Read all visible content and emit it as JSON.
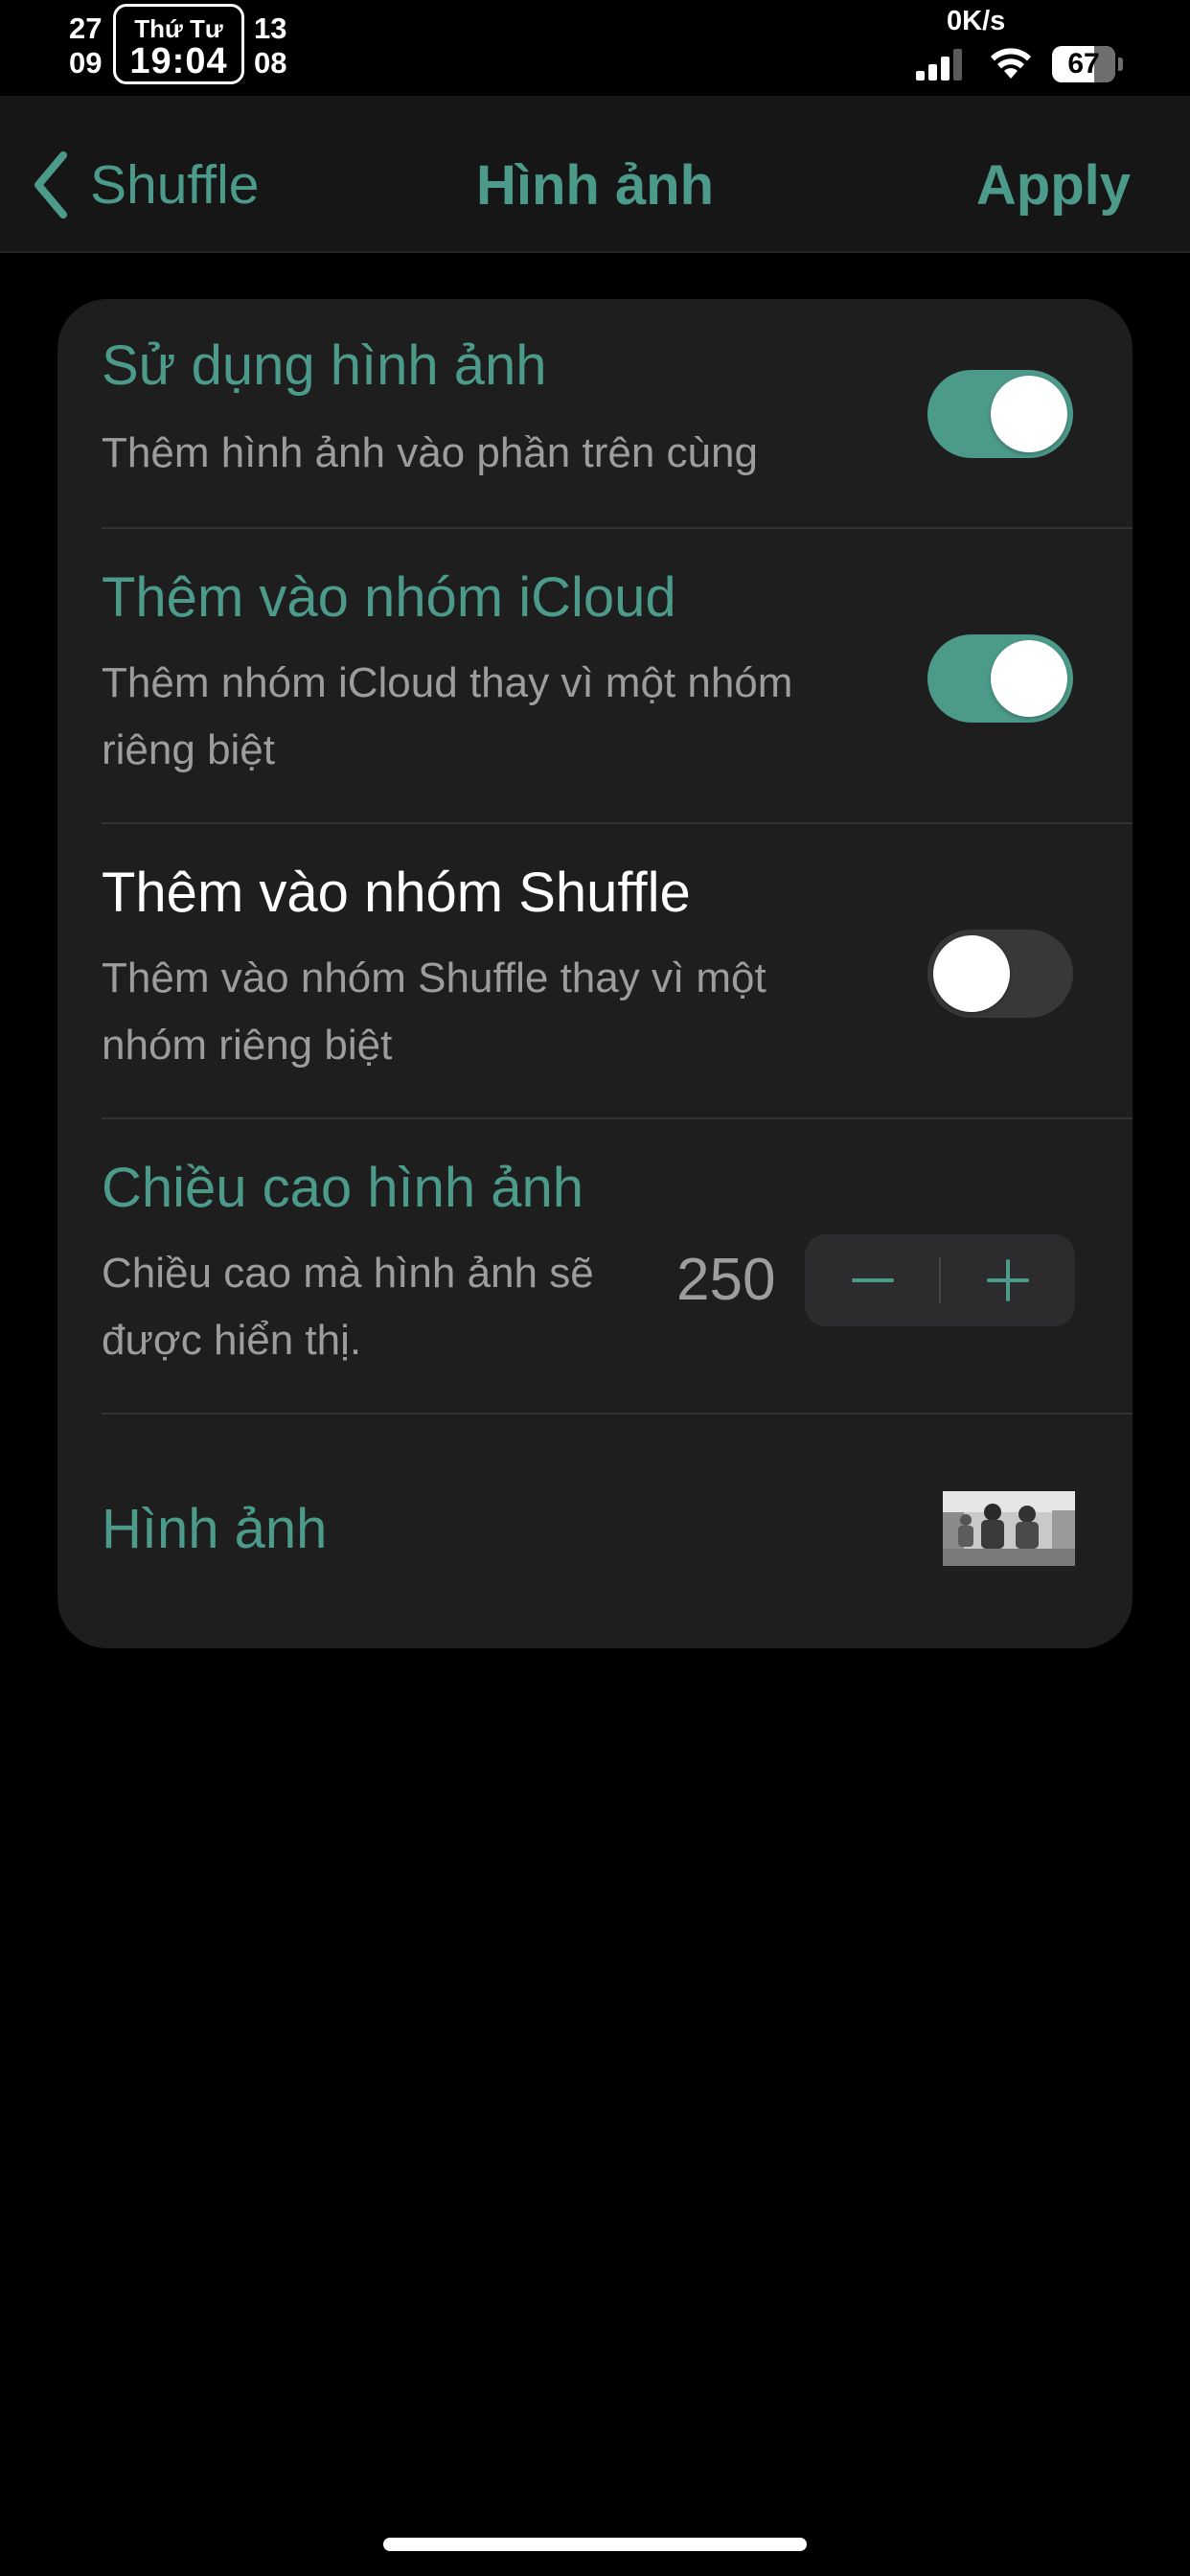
{
  "status_bar": {
    "date_left_top": "27",
    "date_left_bottom": "09",
    "weekday": "Thứ Tư",
    "time": "19:04",
    "date_right_top": "13",
    "date_right_bottom": "08",
    "network_speed": "0K/s",
    "battery_percent": "67",
    "icons": [
      "signal-icon",
      "wifi-icon",
      "battery-icon"
    ]
  },
  "nav": {
    "back_label": "Shuffle",
    "title": "Hình ảnh",
    "apply_label": "Apply"
  },
  "settings": {
    "use_image": {
      "title": "Sử dụng hình ảnh",
      "description": "Thêm hình ảnh vào phần trên cùng",
      "enabled": true
    },
    "icloud_group": {
      "title": "Thêm vào nhóm iCloud",
      "description_line1": "Thêm nhóm iCloud thay vì một nhóm",
      "description_line2": "riêng biệt",
      "enabled": true
    },
    "shuffle_group": {
      "title": "Thêm vào nhóm Shuffle",
      "description_line1": "Thêm vào nhóm Shuffle thay vì một",
      "description_line2": "nhóm riêng biệt",
      "enabled": false
    },
    "image_height": {
      "title": "Chiều cao hình ảnh",
      "description_line1": "Chiều cao mà hình ảnh sẽ",
      "description_line2": "được hiển thị.",
      "value": "250"
    },
    "image": {
      "title": "Hình ảnh"
    }
  },
  "colors": {
    "accent": "#4c9a8a",
    "background": "#000000",
    "card": "#1e1e1f",
    "secondary_text": "#9d9d9f"
  }
}
